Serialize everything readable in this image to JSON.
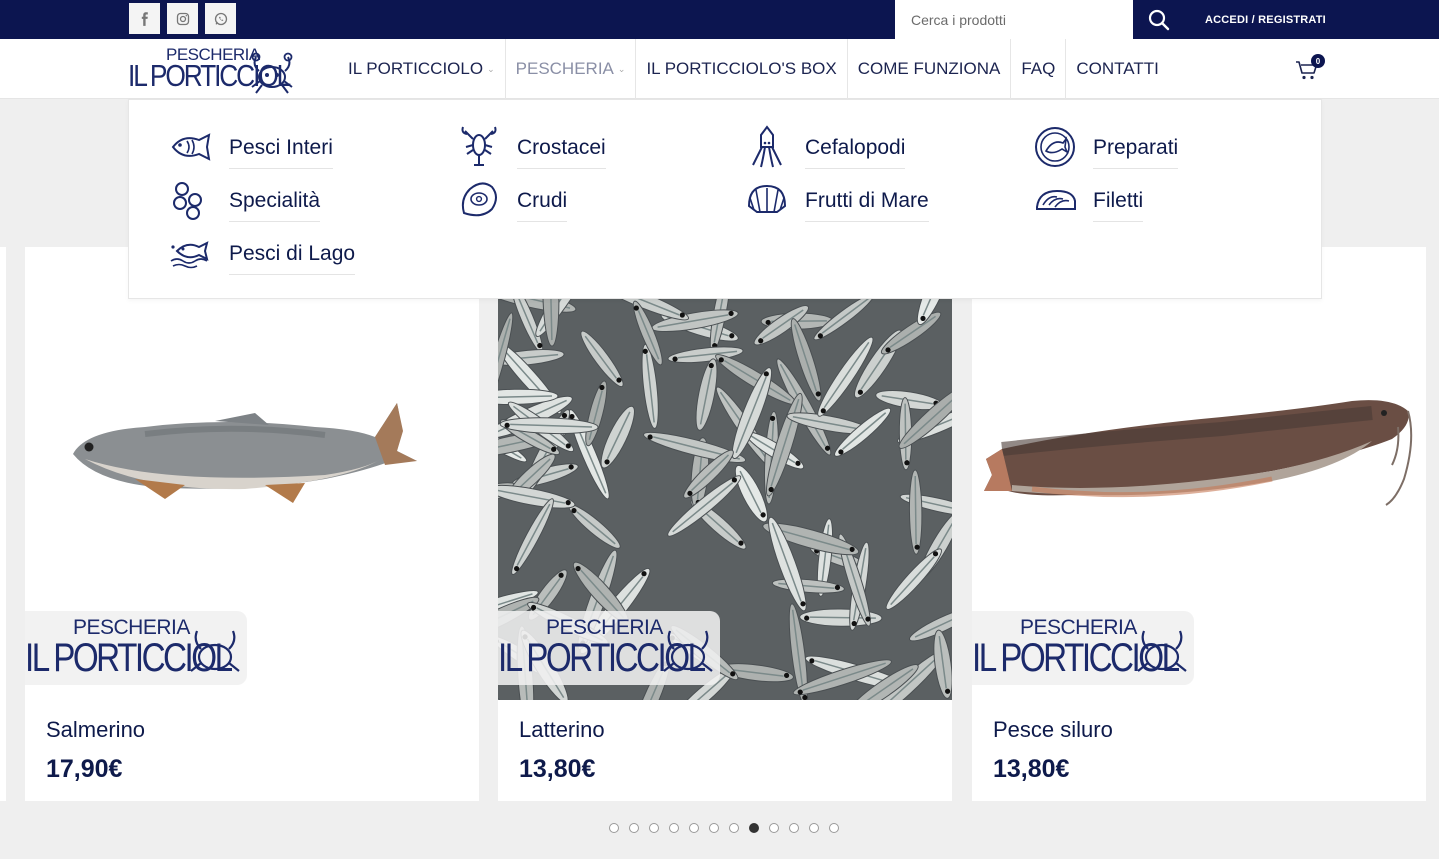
{
  "topbar": {
    "social": [
      {
        "name": "facebook-icon",
        "glyph": "f"
      },
      {
        "name": "instagram-icon",
        "glyph": "ig"
      },
      {
        "name": "whatsapp-icon",
        "glyph": "wa"
      }
    ],
    "search_placeholder": "Cerca i prodotti",
    "login_label": "ACCEDI / REGISTRATI"
  },
  "brand": {
    "line1": "PESCHERIA",
    "line2": "IL PORTICCIOLO"
  },
  "nav": {
    "items": [
      {
        "label": "IL PORTICCIOLO",
        "caret": true
      },
      {
        "label": "PESCHERIA",
        "caret": true
      },
      {
        "label": "IL PORTICCIOLO'S BOX",
        "caret": false
      },
      {
        "label": "COME FUNZIONA",
        "caret": false
      },
      {
        "label": "FAQ",
        "caret": false
      },
      {
        "label": "CONTATTI",
        "caret": false
      }
    ],
    "cart_count": "0"
  },
  "mega_menu": {
    "categories": [
      {
        "label": "Pesci Interi",
        "icon": "fish-icon"
      },
      {
        "label": "Crostacei",
        "icon": "lobster-icon"
      },
      {
        "label": "Cefalopodi",
        "icon": "squid-icon"
      },
      {
        "label": "Preparati",
        "icon": "prepared-plate-icon"
      },
      {
        "label": "Specialità",
        "icon": "fish-eggs-icon"
      },
      {
        "label": "Crudi",
        "icon": "oyster-icon"
      },
      {
        "label": "Frutti di Mare",
        "icon": "shell-icon"
      },
      {
        "label": "Filetti",
        "icon": "fillet-icon"
      },
      {
        "label": "Pesci di Lago",
        "icon": "lake-fish-icon"
      }
    ]
  },
  "products": [
    {
      "name": "Salmerino",
      "price": "17,90€"
    },
    {
      "name": "Latterino",
      "price": "13,80€"
    },
    {
      "name": "Pesce siluro",
      "price": "13,80€"
    }
  ],
  "carousel": {
    "total_dots": 12,
    "active_index": 7
  },
  "colors": {
    "navy": "#0c1550",
    "text": "#0e1a4b",
    "background": "#efefef"
  }
}
